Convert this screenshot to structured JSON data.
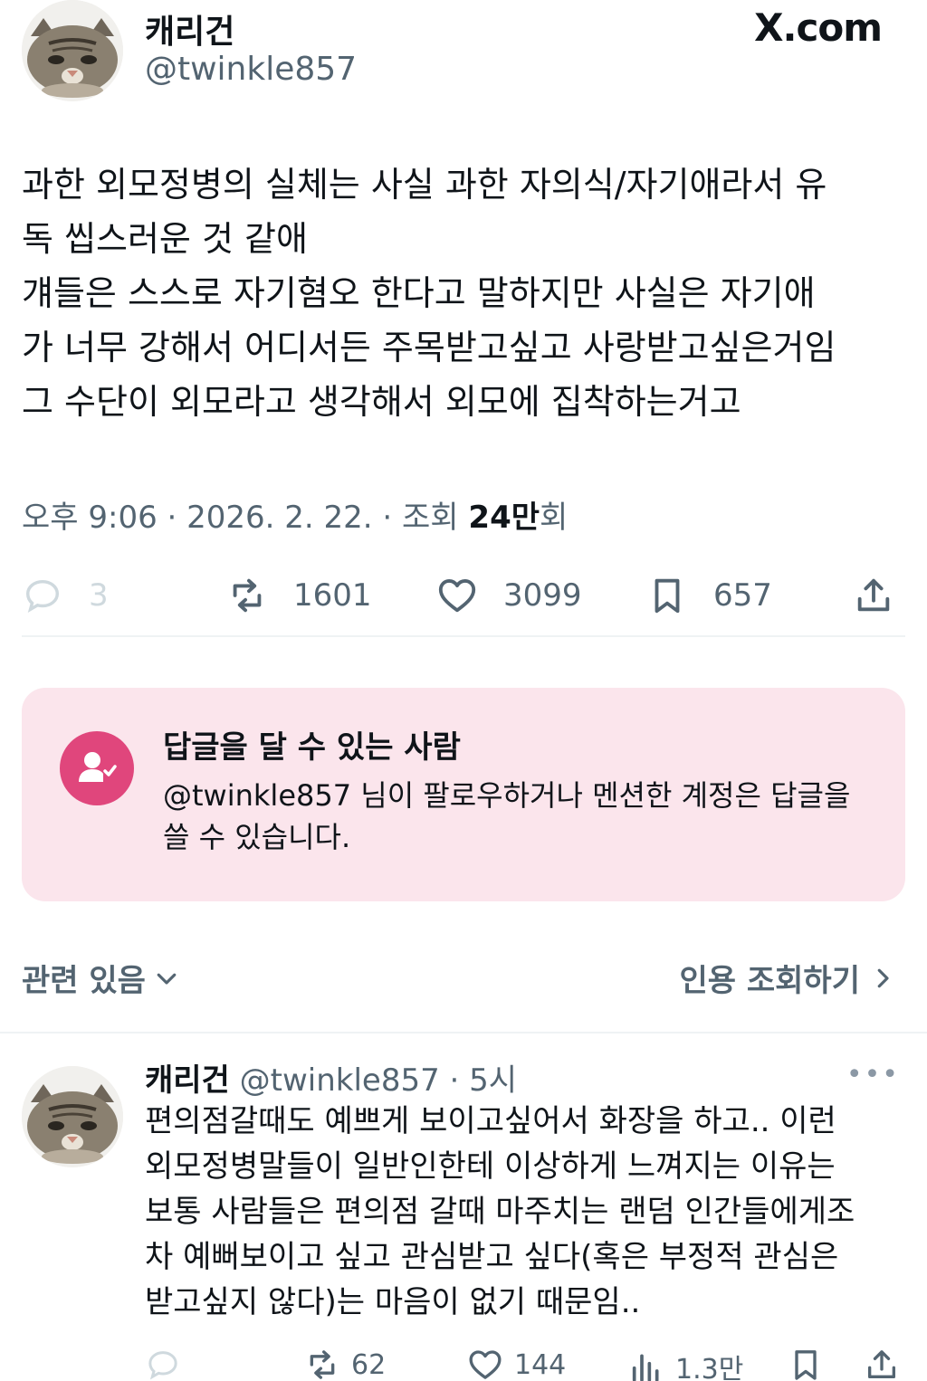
{
  "header": {
    "author_name": "캐리건",
    "author_handle": "@twinkle857",
    "brand": "X.com"
  },
  "tweet": {
    "lines": [
      "과한 외모정병의 실체는 사실 과한 자의식/자기애라서 유",
      "독 씹스러운 것 같애",
      "걔들은 스스로 자기혐오 한다고 말하지만 사실은 자기애",
      "가 너무 강해서 어디서든 주목받고싶고 사랑받고싶은거임",
      "그 수단이 외모라고 생각해서 외모에 집착하는거고"
    ],
    "meta_prefix": "오후 9:06 · 2026. 2. 22. · 조회 ",
    "views_bold": "24만",
    "views_suffix": "회"
  },
  "actions": {
    "replies": "3",
    "retweets": "1601",
    "likes": "3099",
    "bookmarks": "657",
    "icons": [
      "reply-icon",
      "retweet-icon",
      "heart-icon",
      "bookmark-icon",
      "share-icon"
    ]
  },
  "reply_restriction": {
    "title": "답글을 달 수 있는 사람",
    "body": "@twinkle857 님이 팔로우하거나 멘션한 계정은 답글을 쓸 수 있습니다.",
    "accent": "#e0467c",
    "background": "#fbe5ec"
  },
  "links": {
    "related": "관련 있음",
    "quotes": "인용 조회하기"
  },
  "reply": {
    "author_name": "캐리건",
    "handle_time": "@twinkle857 · 5시",
    "more": "•••",
    "lines": [
      "편의점갈때도 예쁘게 보이고싶어서 화장을 하고.. 이런",
      "외모정병말들이 일반인한테 이상하게 느껴지는 이유는",
      "보통 사람들은 편의점 갈때 마주치는 랜덤 인간들에게조",
      "차 예뻐보이고 싶고 관심받고 싶다(혹은 부정적 관심은",
      "받고싶지 않다)는 마음이 없기 때문임.."
    ],
    "retweets": "62",
    "likes": "144",
    "views": "1.3만"
  }
}
